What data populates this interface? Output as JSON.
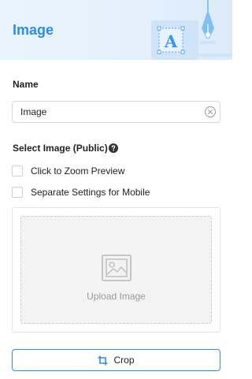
{
  "header": {
    "title": "Image"
  },
  "name_field": {
    "label": "Name",
    "value": "Image"
  },
  "select_image": {
    "label": "Select Image (Public)"
  },
  "options": [
    {
      "label": "Click to Zoom Preview",
      "checked": false
    },
    {
      "label": "Separate Settings for Mobile",
      "checked": false
    }
  ],
  "upload": {
    "label": "Upload Image"
  },
  "crop": {
    "label": "Crop"
  },
  "colors": {
    "accent": "#2b8de6",
    "header_bg": "#e4f0fc"
  }
}
